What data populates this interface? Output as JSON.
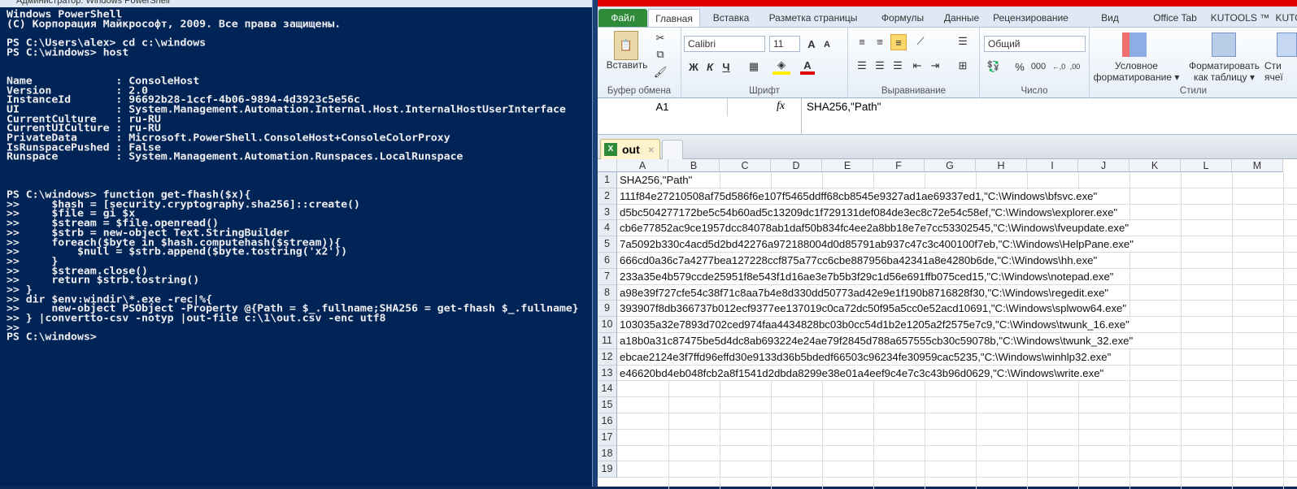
{
  "powershell": {
    "title": "Администратор: Windows PowerShell",
    "lines": [
      "Windows PowerShell",
      "(C) Корпорация Майкрософт, 2009. Все права защищены.",
      "",
      "PS C:\\Users\\alex> cd c:\\windows",
      "PS C:\\windows> host",
      "",
      "",
      "Name             : ConsoleHost",
      "Version          : 2.0",
      "InstanceId       : 96692b28-1ccf-4b06-9894-4d3923c5e56c",
      "UI               : System.Management.Automation.Internal.Host.InternalHostUserInterface",
      "CurrentCulture   : ru-RU",
      "CurrentUICulture : ru-RU",
      "PrivateData      : Microsoft.PowerShell.ConsoleHost+ConsoleColorProxy",
      "IsRunspacePushed : False",
      "Runspace         : System.Management.Automation.Runspaces.LocalRunspace",
      "",
      "",
      "",
      "PS C:\\windows> function get-fhash($x){",
      ">>     $hash = [security.cryptography.sha256]::create()",
      ">>     $file = gi $x",
      ">>     $stream = $file.openread()",
      ">>     $strb = new-object Text.StringBuilder",
      ">>     foreach($byte in $hash.computehash($stream)){",
      ">>         $null = $strb.append($byte.tostring('x2'))",
      ">>     }",
      ">>     $stream.close()",
      ">>     return $strb.tostring()",
      ">> }",
      ">> dir $env:windir\\*.exe -rec|%{",
      ">>     new-object PSObject -Property @{Path = $_.fullname;SHA256 = get-fhash $_.fullname}",
      ">> } |convertto-csv -notyp |out-file c:\\1\\out.csv -enc utf8",
      ">>",
      "PS C:\\windows>"
    ]
  },
  "excel": {
    "ribbon_tabs": [
      "Файл",
      "Главная",
      "Вставка",
      "Разметка страницы",
      "Формулы",
      "Данные",
      "Рецензирование",
      "Вид",
      "Office Tab",
      "KUTOOLS ™",
      "KUTO"
    ],
    "clipboard": {
      "paste": "Вставить",
      "label": "Буфер обмена"
    },
    "font": {
      "name": "Calibri",
      "size": "11",
      "bold": "Ж",
      "italic": "К",
      "underline": "Ч",
      "label": "Шрифт"
    },
    "alignment": {
      "label": "Выравнивание"
    },
    "number": {
      "format": "Общий",
      "percent": "%",
      "thousands": "000",
      "label": "Число"
    },
    "styles": {
      "conditional1": "Условное",
      "conditional2": "форматирование ▾",
      "table1": "Форматировать",
      "table2": "как таблицу ▾",
      "cell1": "Сти",
      "cell2": "ячеї",
      "label": "Стили"
    },
    "name_box": "A1",
    "fx": "fx",
    "formula": "SHA256,\"Path\"",
    "sheet_tab": "out",
    "sheet_tab_close": "×",
    "columns": [
      "A",
      "B",
      "C",
      "D",
      "E",
      "F",
      "G",
      "H",
      "I",
      "J",
      "K",
      "L",
      "M"
    ],
    "rows": [
      "SHA256,\"Path\"",
      "111f84e27210508af75d586f6e107f5465ddff68cb8545e9327ad1ae69337ed1,\"C:\\Windows\\bfsvc.exe\"",
      "d5bc504277172be5c54b60ad5c13209dc1f729131def084de3ec8c72e54c58ef,\"C:\\Windows\\explorer.exe\"",
      "cb6e77852ac9ce1957dcc84078ab1daf50b834fc4ee2a8bb18e7e7cc53302545,\"C:\\Windows\\fveupdate.exe\"",
      "7a5092b330c4acd5d2bd42276a972188004d0d85791ab937c47c3c400100f7eb,\"C:\\Windows\\HelpPane.exe\"",
      "666cd0a36c7a4277bea127228ccf875a77cc6cbe887956ba42341a8e4280b6de,\"C:\\Windows\\hh.exe\"",
      "233a35e4b579ccde25951f8e543f1d16ae3e7b5b3f29c1d56e691ffb075ced15,\"C:\\Windows\\notepad.exe\"",
      "a98e39f727cfe54c38f71c8aa7b4e8d330dd50773ad42e9e1f190b8716828f30,\"C:\\Windows\\regedit.exe\"",
      "393907f8db366737b012ecf9377ee137019c0ca72dc50f95a5cc0e52acd10691,\"C:\\Windows\\splwow64.exe\"",
      "103035a32e7893d702ced974faa4434828bc03b0cc54d1b2e1205a2f2575e7c9,\"C:\\Windows\\twunk_16.exe\"",
      "a18b0a31c87475be5d4dc8ab693224e24ae79f2845d788a657555cb30c59078b,\"C:\\Windows\\twunk_32.exe\"",
      "ebcae2124e3f7ffd96effd30e9133d36b5bdedf66503c96234fe30959cac5235,\"C:\\Windows\\winhlp32.exe\"",
      "e46620bd4eb048fcb2a8f1541d2dbda8299e38e01a4eef9c4e7c3c43b96d0629,\"C:\\Windows\\write.exe\"",
      "",
      "",
      "",
      "",
      "",
      ""
    ]
  }
}
